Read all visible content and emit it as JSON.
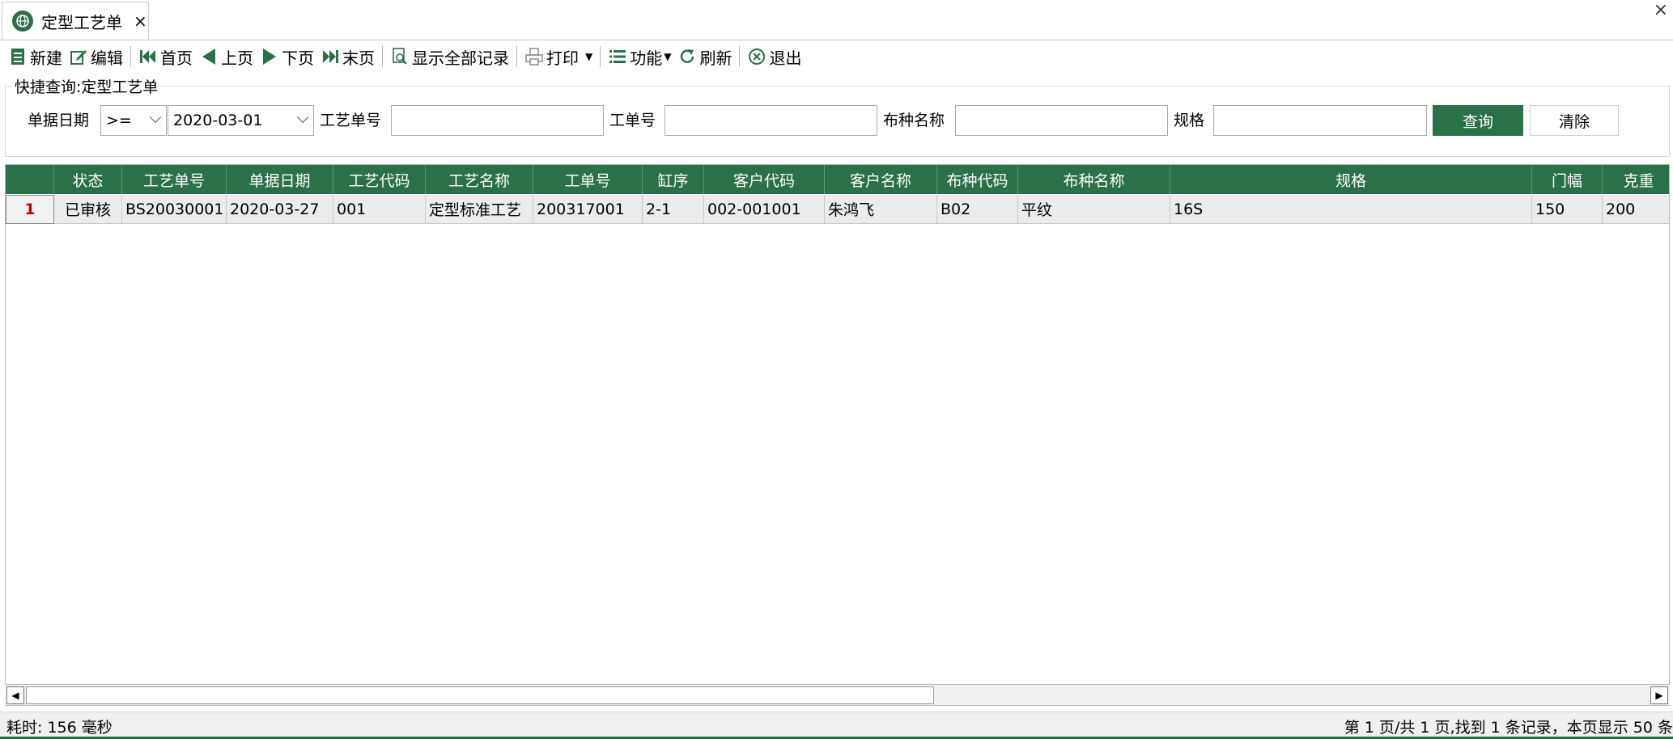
{
  "tab": {
    "title": "定型工艺单",
    "close": "×"
  },
  "window_close": "×",
  "toolbar": {
    "new": "新建",
    "edit": "编辑",
    "first": "首页",
    "prev": "上页",
    "next": "下页",
    "last": "末页",
    "show_all": "显示全部记录",
    "print": "打印",
    "functions": "功能",
    "refresh": "刷新",
    "exit": "退出"
  },
  "quick_search": {
    "legend": "快捷查询:定型工艺单",
    "date_label": "单据日期",
    "operator": ">=",
    "date_value": "2020-03-01",
    "process_no_label": "工艺单号",
    "work_order_label": "工单号",
    "fabric_name_label": "布种名称",
    "spec_label": "规格",
    "query_button": "查询",
    "clear_button": "清除"
  },
  "grid": {
    "columns": [
      "状态",
      "工艺单号",
      "单据日期",
      "工艺代码",
      "工艺名称",
      "工单号",
      "缸序",
      "客户代码",
      "客户名称",
      "布种代码",
      "布种名称",
      "规格",
      "门幅",
      "克重"
    ],
    "rows": [
      {
        "row_no": "1",
        "cells": [
          "已审核",
          "BS20030001",
          "2020-03-27",
          "001",
          "定型标准工艺",
          "200317001",
          "2-1",
          "002-001001",
          "朱鸿飞",
          "B02",
          "平纹",
          "16S",
          "150",
          "200"
        ]
      }
    ]
  },
  "status": {
    "elapsed": "耗时: 156 毫秒",
    "paging": "第 1 页/共 1 页,找到 1 条记录，本页显示 50 条"
  },
  "colors": {
    "accent": "#2a7048",
    "row_number": "#c00000"
  }
}
